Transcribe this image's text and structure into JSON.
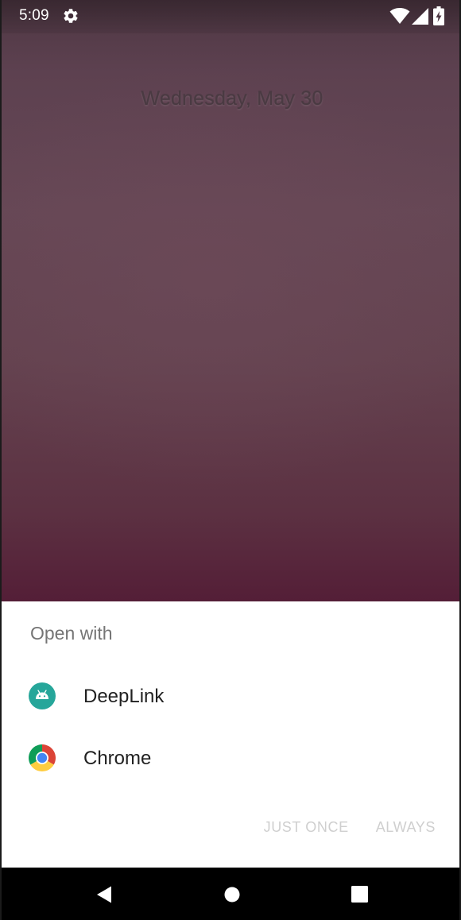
{
  "status_bar": {
    "time": "5:09",
    "icons": [
      "gear-icon",
      "wifi-icon",
      "cell-signal-icon",
      "battery-charging-icon"
    ]
  },
  "lockscreen": {
    "date": "Wednesday, May 30"
  },
  "chooser": {
    "title": "Open with",
    "apps": [
      {
        "label": "DeepLink",
        "icon": "android-icon",
        "icon_color": "#26A69A"
      },
      {
        "label": "Chrome",
        "icon": "chrome-icon"
      }
    ],
    "actions": {
      "just_once": "JUST ONCE",
      "always": "ALWAYS"
    }
  },
  "nav_bar": {
    "icons": [
      "back-icon",
      "home-icon",
      "recents-icon"
    ]
  }
}
